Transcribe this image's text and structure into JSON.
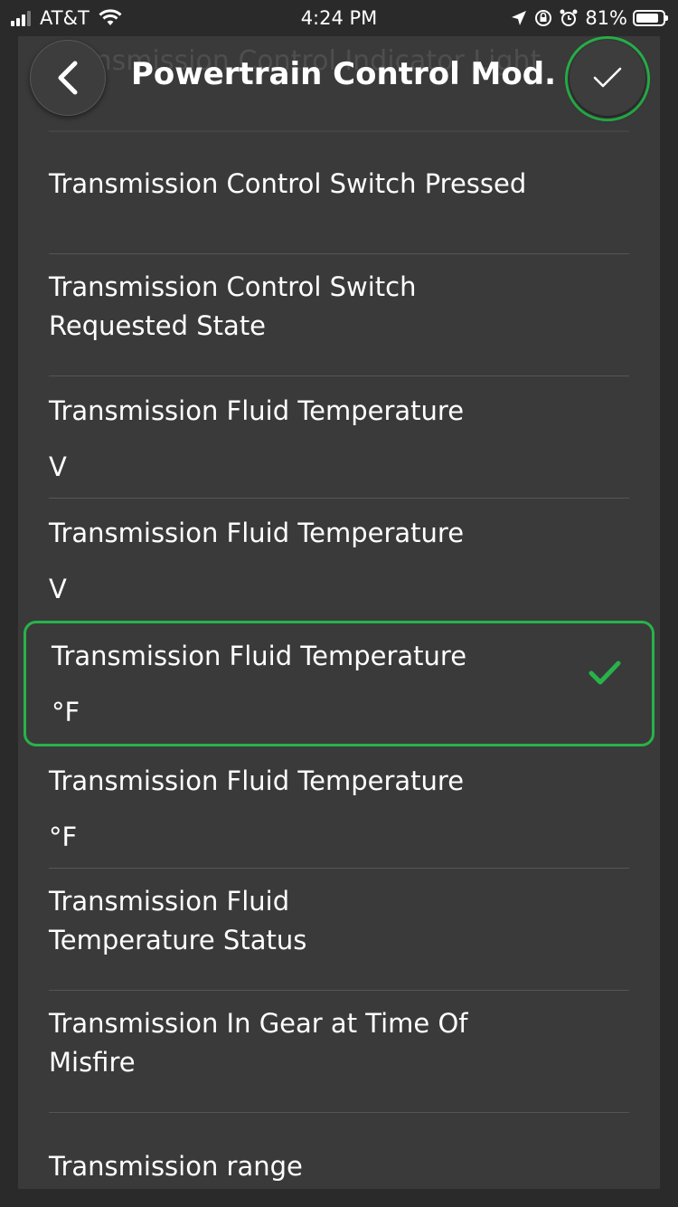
{
  "status_bar": {
    "carrier": "AT&T",
    "time": "4:24 PM",
    "battery": "81%"
  },
  "header": {
    "title": "Powertrain Control Mod...",
    "ghost_text": "Transmission Control Indicator Light"
  },
  "items": [
    {
      "name": "Transmission Control Switch Pressed",
      "unit": ""
    },
    {
      "name": "Transmission Control Switch Requested State",
      "unit": ""
    },
    {
      "name": "Transmission Fluid Temperature",
      "unit": "V"
    },
    {
      "name": "Transmission Fluid Temperature",
      "unit": "V"
    },
    {
      "name": "Transmission Fluid Temperature",
      "unit": "°F",
      "selected": true
    },
    {
      "name": "Transmission Fluid Temperature",
      "unit": "°F"
    },
    {
      "name": "Transmission Fluid Temperature Status",
      "unit": ""
    },
    {
      "name": "Transmission In Gear at Time Of Misfire",
      "unit": ""
    },
    {
      "name": "Transmission range",
      "unit": ""
    }
  ],
  "colors": {
    "accent": "#27b34a",
    "background": "#2a2a2a",
    "sheet": "#3a3a3a"
  }
}
